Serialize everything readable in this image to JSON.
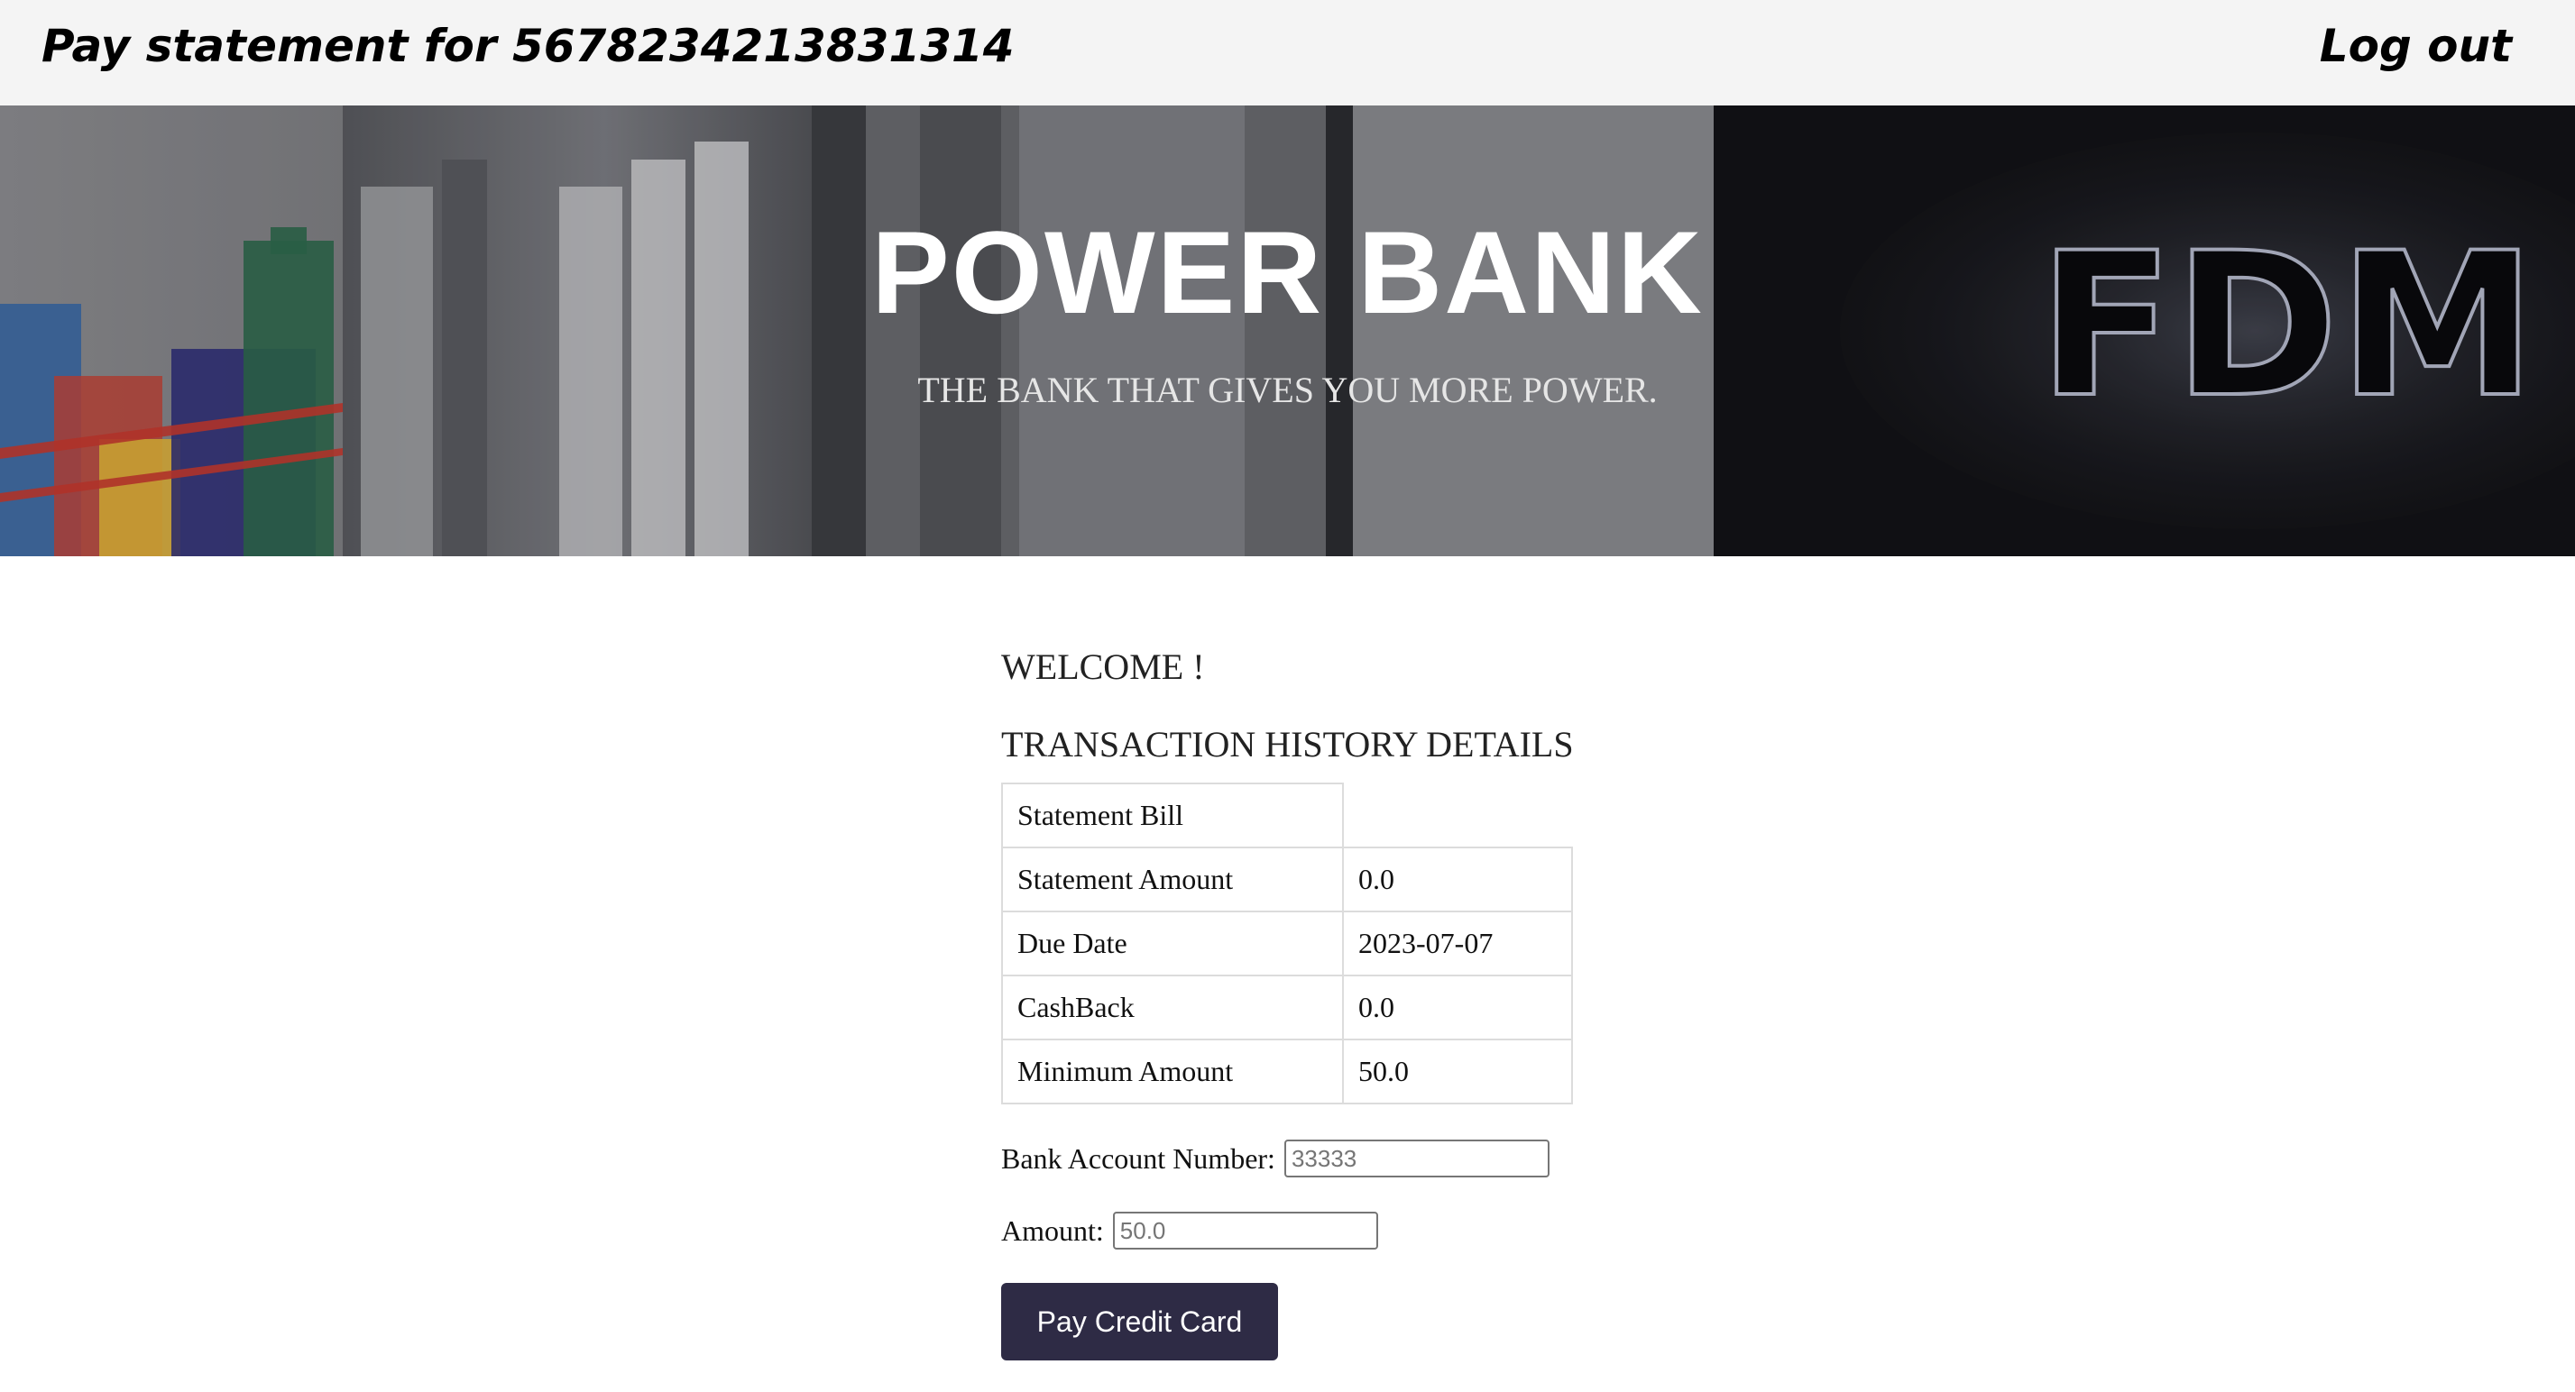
{
  "header": {
    "title": "Pay statement for 5678234213831314",
    "logout_label": "Log out"
  },
  "hero": {
    "heading": "POWER BANK",
    "tagline": "THE BANK THAT GIVES YOU MORE POWER.",
    "sign_text": "FDM"
  },
  "main": {
    "welcome": "WELCOME !",
    "history_title": "TRANSACTION HISTORY DETAILS",
    "statement": {
      "header_label": "Statement Bill",
      "rows": [
        {
          "label": "Statement Amount",
          "value": "0.0"
        },
        {
          "label": "Due Date",
          "value": "2023-07-07"
        },
        {
          "label": "CashBack",
          "value": "0.0"
        },
        {
          "label": "Minimum Amount",
          "value": "50.0"
        }
      ]
    },
    "form": {
      "bank_account_label": "Bank Account Number:",
      "bank_account_placeholder": "33333",
      "amount_label": "Amount:",
      "amount_placeholder": "50.0",
      "submit_label": "Pay Credit Card"
    }
  },
  "colors": {
    "topbar_bg": "#f4f4f4",
    "button_bg": "#2e2b45",
    "table_border": "#dcdcdc"
  }
}
